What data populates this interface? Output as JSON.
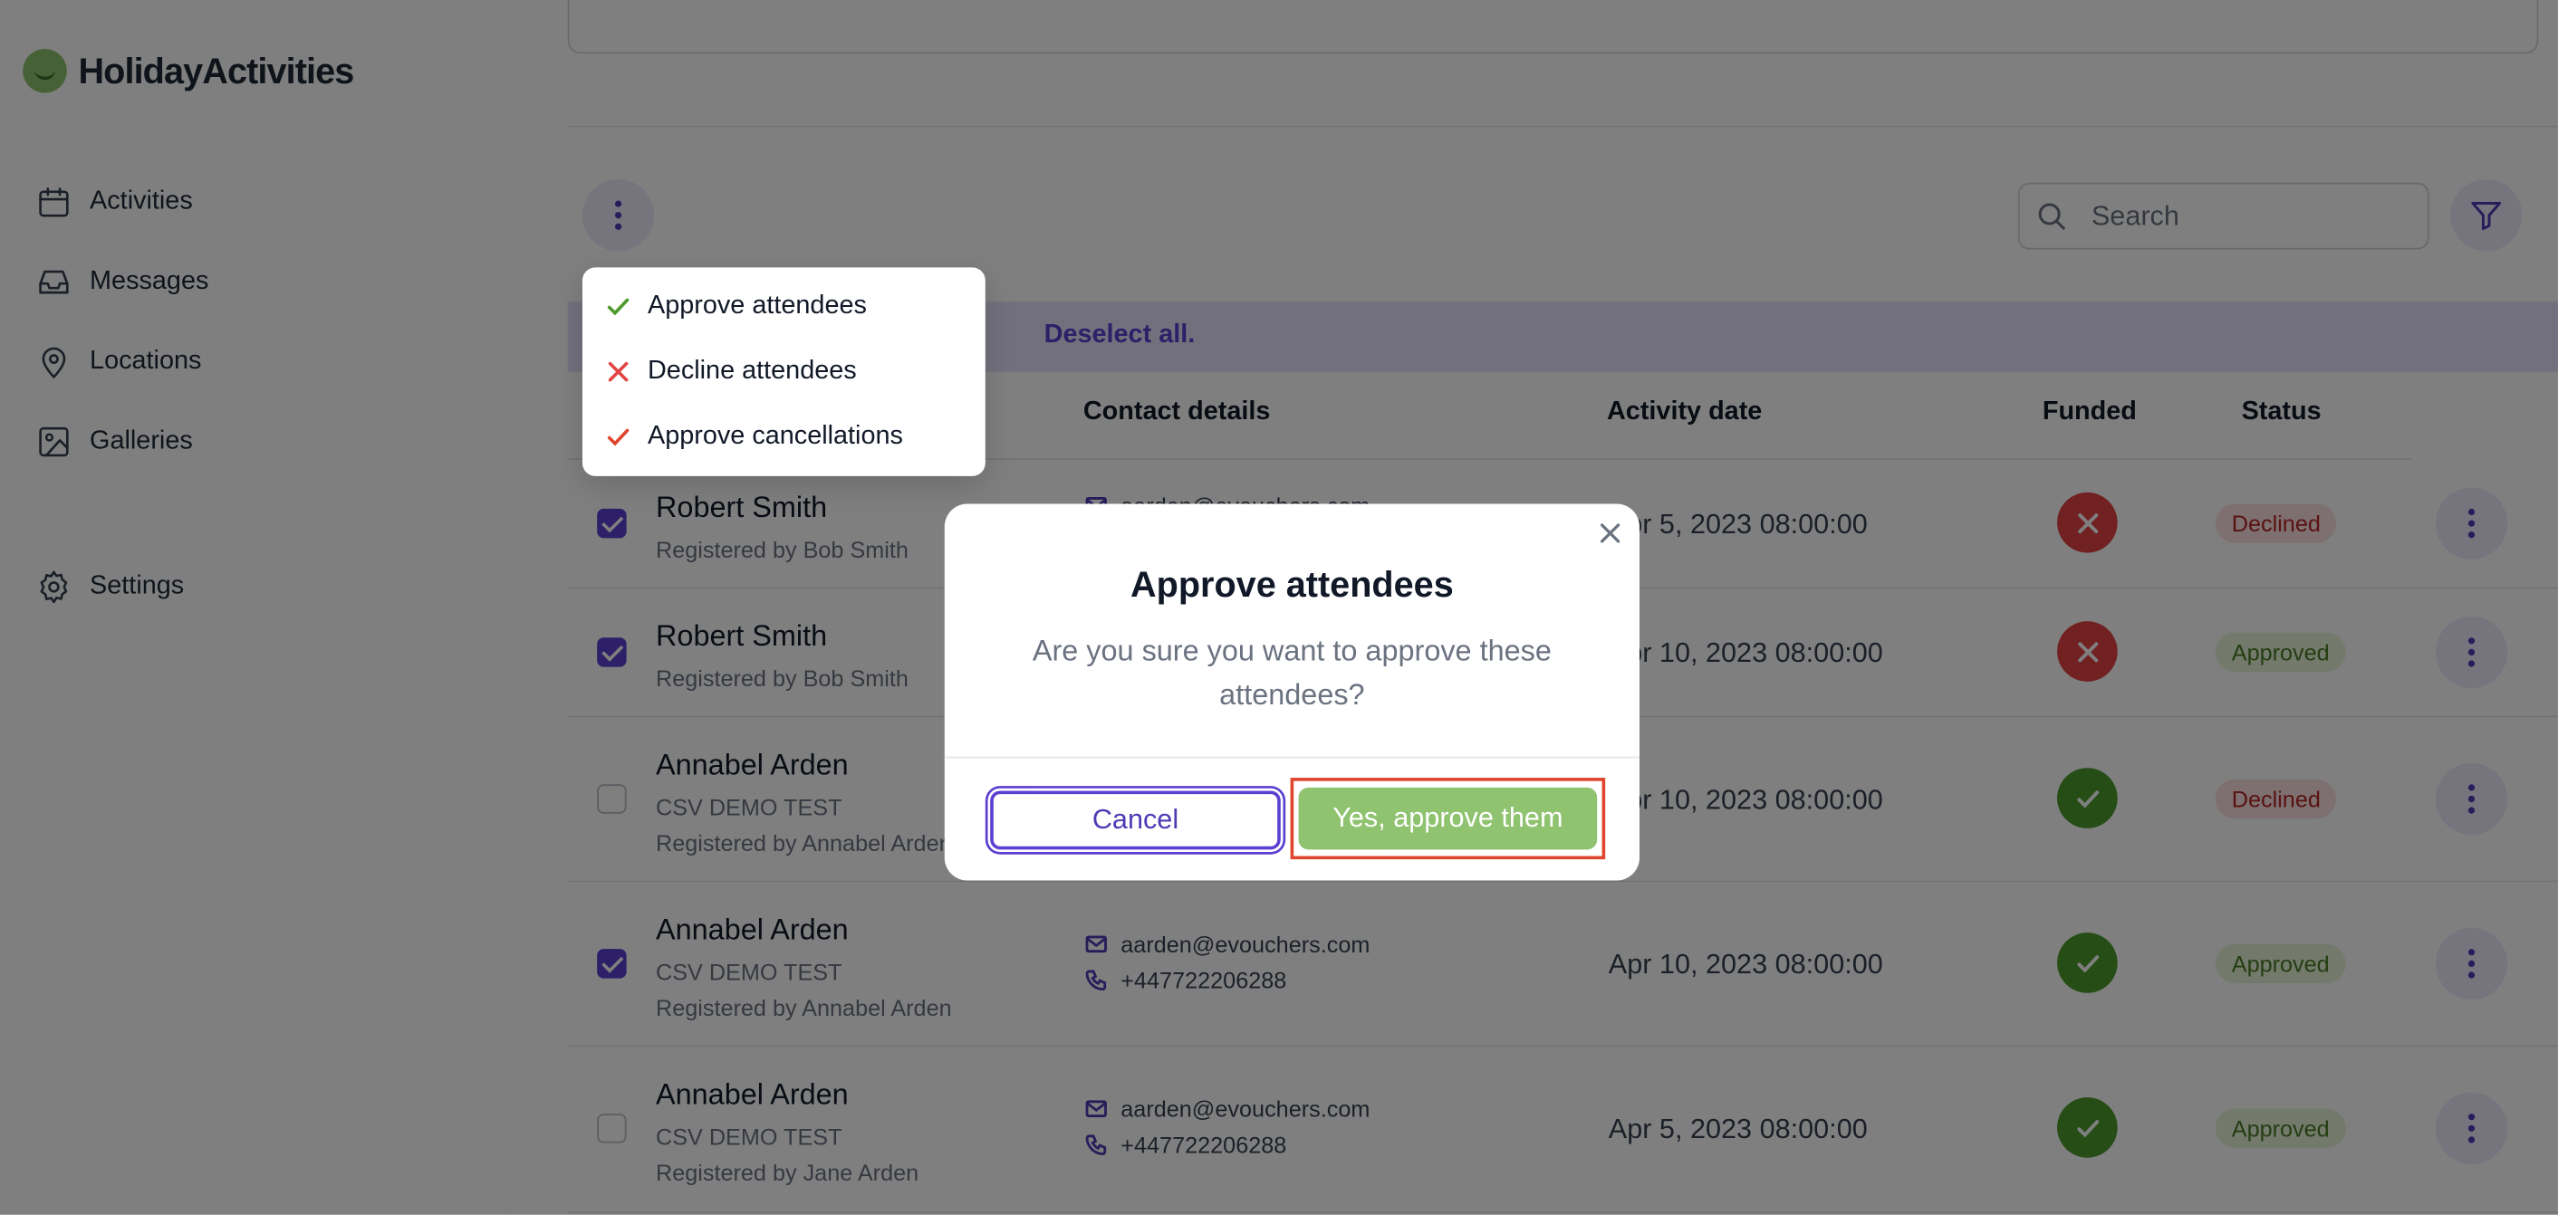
{
  "app": {
    "brand": "HolidayActivities"
  },
  "sidebar": {
    "items": [
      {
        "label": "Activities",
        "icon": "calendar-icon"
      },
      {
        "label": "Messages",
        "icon": "inbox-icon"
      },
      {
        "label": "Locations",
        "icon": "location-pin-icon"
      },
      {
        "label": "Galleries",
        "icon": "image-icon"
      },
      {
        "label": "Settings",
        "icon": "gear-icon"
      }
    ]
  },
  "toolbar": {
    "search_placeholder": "Search"
  },
  "selection_banner": {
    "deselect_label": "Deselect all."
  },
  "table": {
    "headers": {
      "contact": "Contact details",
      "date": "Activity date",
      "funded": "Funded",
      "status": "Status"
    },
    "rows": [
      {
        "checked": true,
        "name": "Robert Smith",
        "lines": [
          "Registered by Bob Smith"
        ],
        "email": "aarden@evouchers.com",
        "phone": "",
        "date": "Apr 5, 2023 08:00:00",
        "funded": false,
        "status": "Declined"
      },
      {
        "checked": true,
        "name": "Robert Smith",
        "lines": [
          "Registered by Bob Smith"
        ],
        "email": "",
        "phone": "",
        "date": "Apr 10, 2023 08:00:00",
        "funded": false,
        "status": "Approved"
      },
      {
        "checked": false,
        "name": "Annabel Arden",
        "lines": [
          "CSV DEMO TEST",
          "Registered by Annabel Arden"
        ],
        "email": "",
        "phone": "",
        "date": "Apr 10, 2023 08:00:00",
        "funded": true,
        "status": "Declined"
      },
      {
        "checked": true,
        "name": "Annabel Arden",
        "lines": [
          "CSV DEMO TEST",
          "Registered by Annabel Arden"
        ],
        "email": "aarden@evouchers.com",
        "phone": "+447722206288",
        "date": "Apr 10, 2023 08:00:00",
        "funded": true,
        "status": "Approved"
      },
      {
        "checked": false,
        "name": "Annabel Arden",
        "lines": [
          "CSV DEMO TEST",
          "Registered by Jane Arden"
        ],
        "email": "aarden@evouchers.com",
        "phone": "+447722206288",
        "date": "Apr 5, 2023 08:00:00",
        "funded": true,
        "status": "Approved"
      }
    ]
  },
  "bulk_menu": {
    "items": [
      {
        "label": "Approve attendees",
        "icon": "check-icon",
        "color": "#4c9a2a"
      },
      {
        "label": "Decline attendees",
        "icon": "x-icon",
        "color": "#e24343"
      },
      {
        "label": "Approve cancellations",
        "icon": "check-icon",
        "color": "#e0452d"
      }
    ]
  },
  "modal": {
    "title": "Approve attendees",
    "message": "Are you sure you want to approve these attendees?",
    "cancel_label": "Cancel",
    "confirm_label": "Yes, approve them"
  },
  "colors": {
    "accent": "#5b3fd1",
    "brand_green": "#8fc36f",
    "danger": "#e24343"
  }
}
